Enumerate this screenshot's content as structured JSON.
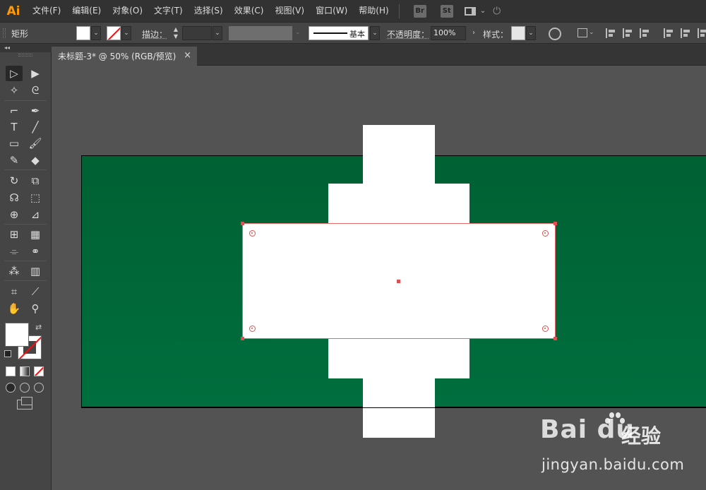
{
  "app": {
    "logo": "Ai"
  },
  "menu": {
    "items": [
      "文件(F)",
      "编辑(E)",
      "对象(O)",
      "文字(T)",
      "选择(S)",
      "效果(C)",
      "视图(V)",
      "窗口(W)",
      "帮助(H)"
    ],
    "bridge_label": "Br",
    "stock_label": "St"
  },
  "control_bar": {
    "shape_name": "矩形",
    "fill_color": "#ffffff",
    "stroke_color": "none",
    "stroke_label": "描边：",
    "stroke_value": "",
    "brush_label": "基本",
    "opacity_label": "不透明度：",
    "opacity_value": "100%",
    "style_label": "样式："
  },
  "document": {
    "tab_title": "未标题-3* @ 50% (RGB/预览)",
    "close_glyph": "×"
  },
  "canvas": {
    "artboard_color": "#006834",
    "shape_fill": "#ffffff",
    "selection_color": "#e05050"
  },
  "toolbar": {
    "collapse_glyph": "◂◂",
    "tools": [
      {
        "name": "selection-tool",
        "glyph": "▷"
      },
      {
        "name": "direct-selection-tool",
        "glyph": "▶"
      },
      {
        "name": "magic-wand-tool",
        "glyph": "✧"
      },
      {
        "name": "lasso-tool",
        "glyph": "ᘓ"
      },
      {
        "name": "curvature-tool",
        "glyph": "⌐"
      },
      {
        "name": "pen-tool",
        "glyph": "✒"
      },
      {
        "name": "type-tool",
        "glyph": "T"
      },
      {
        "name": "line-tool",
        "glyph": "╱"
      },
      {
        "name": "rectangle-tool",
        "glyph": "▭"
      },
      {
        "name": "paintbrush-tool",
        "glyph": "🖌"
      },
      {
        "name": "pencil-tool",
        "glyph": "✎"
      },
      {
        "name": "eraser-tool",
        "glyph": "◆"
      },
      {
        "name": "rotate-tool",
        "glyph": "↻"
      },
      {
        "name": "scale-tool",
        "glyph": "⧉"
      },
      {
        "name": "warp-tool",
        "glyph": "☊"
      },
      {
        "name": "free-transform-tool",
        "glyph": "⬚"
      },
      {
        "name": "shape-builder-tool",
        "glyph": "⊕"
      },
      {
        "name": "perspective-grid-tool",
        "glyph": "⊿"
      },
      {
        "name": "mesh-tool",
        "glyph": "⊞"
      },
      {
        "name": "gradient-tool",
        "glyph": "▦"
      },
      {
        "name": "eyedropper-tool",
        "glyph": "⌯"
      },
      {
        "name": "blend-tool",
        "glyph": "⚭"
      },
      {
        "name": "symbol-sprayer-tool",
        "glyph": "⁂"
      },
      {
        "name": "column-graph-tool",
        "glyph": "▥"
      },
      {
        "name": "artboard-tool",
        "glyph": "⌗"
      },
      {
        "name": "slice-tool",
        "glyph": "⟋"
      },
      {
        "name": "hand-tool",
        "glyph": "✋"
      },
      {
        "name": "zoom-tool",
        "glyph": "⚲"
      }
    ],
    "swap_glyph": "⇄"
  },
  "watermark": {
    "logo": "Bai du",
    "title": "经验",
    "url": "jingyan.baidu.com"
  }
}
